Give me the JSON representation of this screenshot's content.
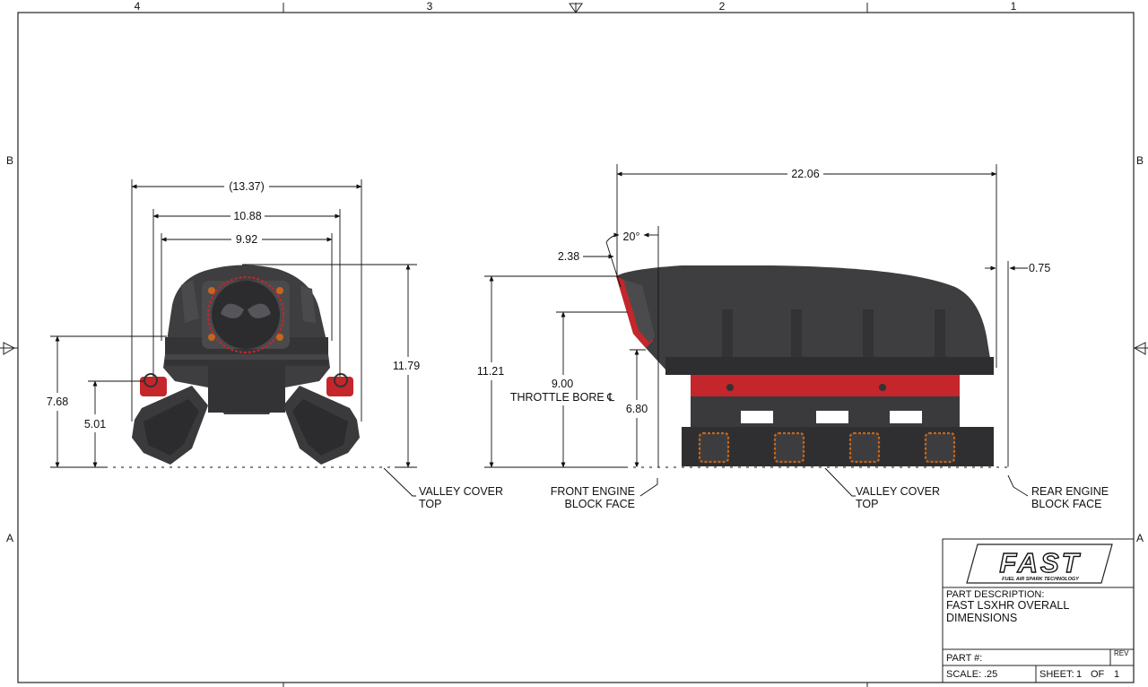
{
  "zones": {
    "columns": [
      "4",
      "3",
      "2",
      "1"
    ],
    "rows_left": [
      "B",
      "A"
    ],
    "rows_right": [
      "B",
      "A"
    ]
  },
  "front_view": {
    "dims": {
      "overall_width": "(13.37)",
      "width_mid": "10.88",
      "width_inner": "9.92",
      "overall_height": "11.79",
      "height_flange": "7.68",
      "height_fuel": "5.01"
    },
    "callout": {
      "line1": "VALLEY COVER",
      "line2": "TOP"
    }
  },
  "side_view": {
    "dims": {
      "overall_length": "22.06",
      "angle": "20°",
      "offset_front": "2.38",
      "offset_rear": "0.75",
      "overall_height": "11.21",
      "throttle_height": "9.00",
      "throttle_label": "THROTTLE BORE ℄",
      "base_height": "6.80"
    },
    "callouts": {
      "front_block": {
        "line1": "FRONT ENGINE",
        "line2": "BLOCK FACE"
      },
      "valley": {
        "line1": "VALLEY COVER",
        "line2": "TOP"
      },
      "rear_block": {
        "line1": "REAR ENGINE",
        "line2": "BLOCK FACE"
      }
    }
  },
  "title_block": {
    "logo_text": "FAST",
    "logo_tagline": "FUEL AIR SPARK TECHNOLOGY",
    "description_label": "PART DESCRIPTION:",
    "description_line1": "FAST LSXHR OVERALL",
    "description_line2": "DIMENSIONS",
    "part_label": "PART #:",
    "rev_label": "REV",
    "scale_label": "SCALE:",
    "scale_value": ".25",
    "sheet_label": "SHEET:",
    "sheet_number": "1",
    "sheet_of": "OF",
    "sheet_total": "1"
  },
  "colors": {
    "body": "#3c3c3e",
    "body_dark": "#2a2a2c",
    "body_light": "#58585a",
    "accent_red": "#c4262b",
    "port_orange": "#c4661c"
  }
}
